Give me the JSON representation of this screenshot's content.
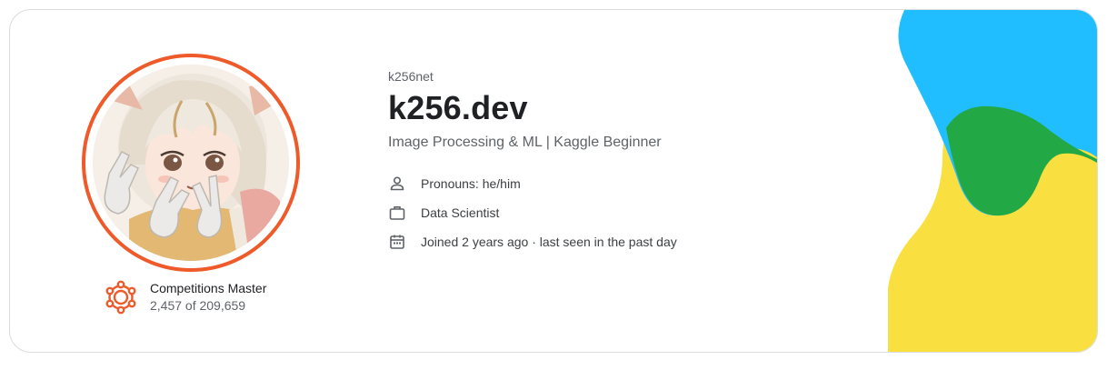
{
  "profile": {
    "username": "k256net",
    "display_name": "k256.dev",
    "bio": "Image Processing & ML | Kaggle Beginner",
    "avatar_icon": "anime-avatar-image"
  },
  "tier": {
    "name": "Competitions Master",
    "rank": "2,457 of 209,659",
    "icon": "competitions-tier-icon",
    "color": "#ef5a2a"
  },
  "details": {
    "pronouns": "Pronouns: he/him",
    "occupation": "Data Scientist",
    "joined": "Joined 2 years ago · last seen in the past day"
  },
  "colors": {
    "accent_orange": "#ef5a2a",
    "decor_blue": "#20beff",
    "decor_green": "#22a844",
    "decor_yellow": "#f9e040"
  }
}
